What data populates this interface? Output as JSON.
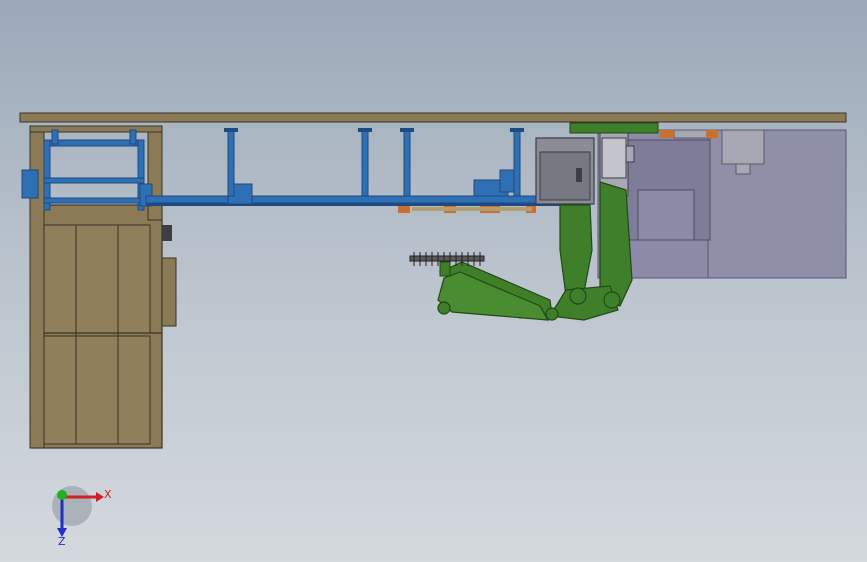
{
  "viewport": {
    "colors": {
      "frame_wood": "#8a7a56",
      "frame_dark": "#3a3324",
      "rail_blue": "#2f6fb4",
      "rail_dark": "#1d4a80",
      "robot_green": "#3f7f2a",
      "robot_dark": "#1f4a14",
      "machine_lavender": "#8d8aa8",
      "machine_grey": "#a7a8b3",
      "panel_grey": "#8b8c95",
      "pad_orange": "#c9702c"
    }
  },
  "triad": {
    "x_label": "X",
    "z_label": "Z",
    "x_color": "#d12020",
    "y_color": "#20b020",
    "z_color": "#2030c0"
  }
}
